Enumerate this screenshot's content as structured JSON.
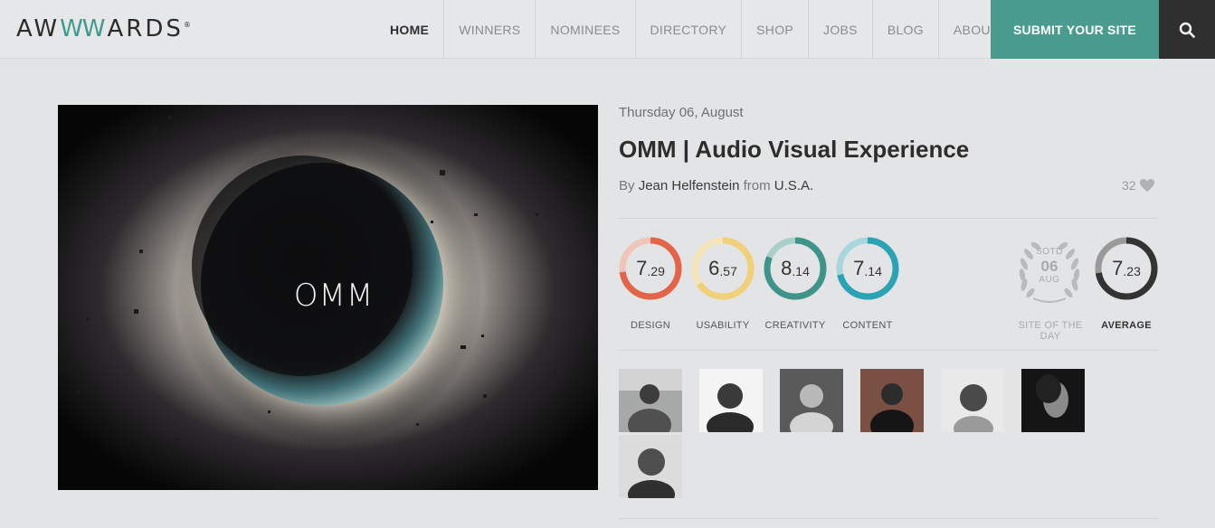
{
  "header": {
    "logo": {
      "prefix": "AW",
      "highlight": "WW",
      "suffix": "ARDS",
      "mark": "®"
    },
    "nav": [
      "HOME",
      "WINNERS",
      "NOMINEES",
      "DIRECTORY",
      "SHOP",
      "JOBS",
      "BLOG",
      "ABOUT US"
    ],
    "submit_label": "SUBMIT YOUR SITE",
    "search_icon": "search-icon"
  },
  "hero": {
    "image_text": "OMM"
  },
  "details": {
    "date": "Thursday 06, August",
    "title": "OMM | Audio Visual Experience",
    "by_label": "By",
    "author": "Jean Helfenstein",
    "from_label": "from",
    "country": "U.S.A.",
    "likes": "32",
    "likes_icon": "heart-icon"
  },
  "scores": [
    {
      "label": "DESIGN",
      "int": "7",
      "dec": ".29",
      "value": 7.29,
      "color": "#e2654a",
      "track": "#f0c4b8"
    },
    {
      "label": "USABILITY",
      "int": "6",
      "dec": ".57",
      "value": 6.57,
      "color": "#f0d078",
      "track": "#f5e5b8"
    },
    {
      "label": "CREATIVITY",
      "int": "8",
      "dec": ".14",
      "value": 8.14,
      "color": "#3f948a",
      "track": "#a9cfca"
    },
    {
      "label": "CONTENT",
      "int": "7",
      "dec": ".14",
      "value": 7.14,
      "color": "#2aa3b4",
      "track": "#a8d6dd"
    }
  ],
  "sotd": {
    "line1": "SOTD",
    "line2": "06",
    "line3": "AUG",
    "label": "SITE OF THE DAY"
  },
  "average": {
    "label": "AVERAGE",
    "int": "7",
    "dec": ".23",
    "value": 7.23,
    "color": "#333333",
    "track": "#999999"
  },
  "jury_count": 7
}
